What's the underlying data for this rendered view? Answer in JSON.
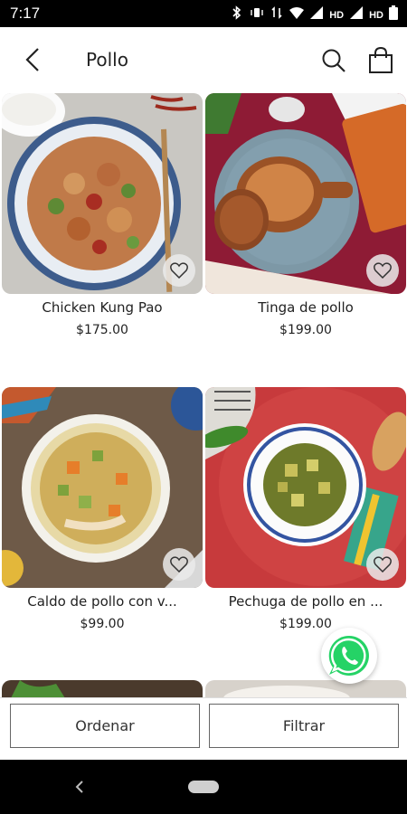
{
  "status_bar": {
    "time": "7:17",
    "hd1": "HD",
    "hd2": "HD"
  },
  "header": {
    "title": "Pollo",
    "back_icon": "arrow-left-icon",
    "search_icon": "search-icon",
    "cart_icon": "shopping-bag-icon"
  },
  "products": [
    {
      "name": "Chicken Kung Pao",
      "price": "$175.00"
    },
    {
      "name": "Tinga de pollo",
      "price": "$199.00"
    },
    {
      "name": "Caldo de pollo con v...",
      "price": "$99.00"
    },
    {
      "name": "Pechuga de pollo en ...",
      "price": "$199.00"
    }
  ],
  "actions": {
    "sort_label": "Ordenar",
    "filter_label": "Filtrar"
  },
  "colors": {
    "whatsapp": "#25D366",
    "text": "#222222"
  }
}
